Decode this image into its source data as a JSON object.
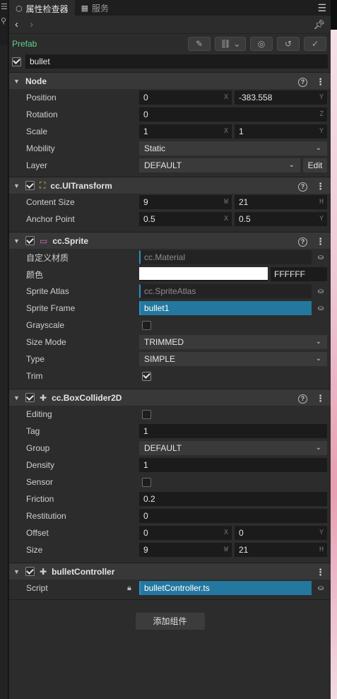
{
  "tabs": [
    {
      "label": "属性检查器",
      "icon": "inspector-icon",
      "active": true
    },
    {
      "label": "服务",
      "icon": "services-icon",
      "active": false
    }
  ],
  "prefab": {
    "label": "Prefab"
  },
  "node_name": "bullet",
  "node": {
    "title": "Node",
    "position": {
      "label": "Position",
      "x": "0",
      "y": "-383.558"
    },
    "rotation": {
      "label": "Rotation",
      "z": "0"
    },
    "scale": {
      "label": "Scale",
      "x": "1",
      "y": "1"
    },
    "mobility": {
      "label": "Mobility",
      "value": "Static"
    },
    "layer": {
      "label": "Layer",
      "value": "DEFAULT",
      "edit": "Edit"
    }
  },
  "uitransform": {
    "title": "cc.UITransform",
    "content_size": {
      "label": "Content Size",
      "w": "9",
      "h": "21"
    },
    "anchor_point": {
      "label": "Anchor Point",
      "x": "0.5",
      "y": "0.5"
    }
  },
  "sprite": {
    "title": "cc.Sprite",
    "material": {
      "label": "自定义材质",
      "value": "cc.Material"
    },
    "color": {
      "label": "颜色",
      "hex": "FFFFFF",
      "swatch": "#ffffff"
    },
    "atlas": {
      "label": "Sprite Atlas",
      "value": "cc.SpriteAtlas"
    },
    "frame": {
      "label": "Sprite Frame",
      "value": "bullet1"
    },
    "grayscale": {
      "label": "Grayscale",
      "checked": false
    },
    "size_mode": {
      "label": "Size Mode",
      "value": "TRIMMED"
    },
    "type": {
      "label": "Type",
      "value": "SIMPLE"
    },
    "trim": {
      "label": "Trim",
      "checked": true
    }
  },
  "boxcollider": {
    "title": "cc.BoxCollider2D",
    "editing": {
      "label": "Editing",
      "checked": false
    },
    "tag": {
      "label": "Tag",
      "value": "1"
    },
    "group": {
      "label": "Group",
      "value": "DEFAULT"
    },
    "density": {
      "label": "Density",
      "value": "1"
    },
    "sensor": {
      "label": "Sensor",
      "checked": false
    },
    "friction": {
      "label": "Friction",
      "value": "0.2"
    },
    "restitution": {
      "label": "Restitution",
      "value": "0"
    },
    "offset": {
      "label": "Offset",
      "x": "0",
      "y": "0"
    },
    "size": {
      "label": "Size",
      "w": "9",
      "h": "21"
    }
  },
  "controller": {
    "title": "bulletController",
    "script": {
      "label": "Script",
      "value": "bulletController.ts"
    }
  },
  "add_component": "添加组件",
  "axis": {
    "x": "X",
    "y": "Y",
    "z": "Z",
    "w": "W",
    "h": "H"
  },
  "colors": {
    "accent": "#24789f",
    "prefab": "#5fd08c",
    "panel": "#2c2c2c",
    "header": "#383838"
  }
}
